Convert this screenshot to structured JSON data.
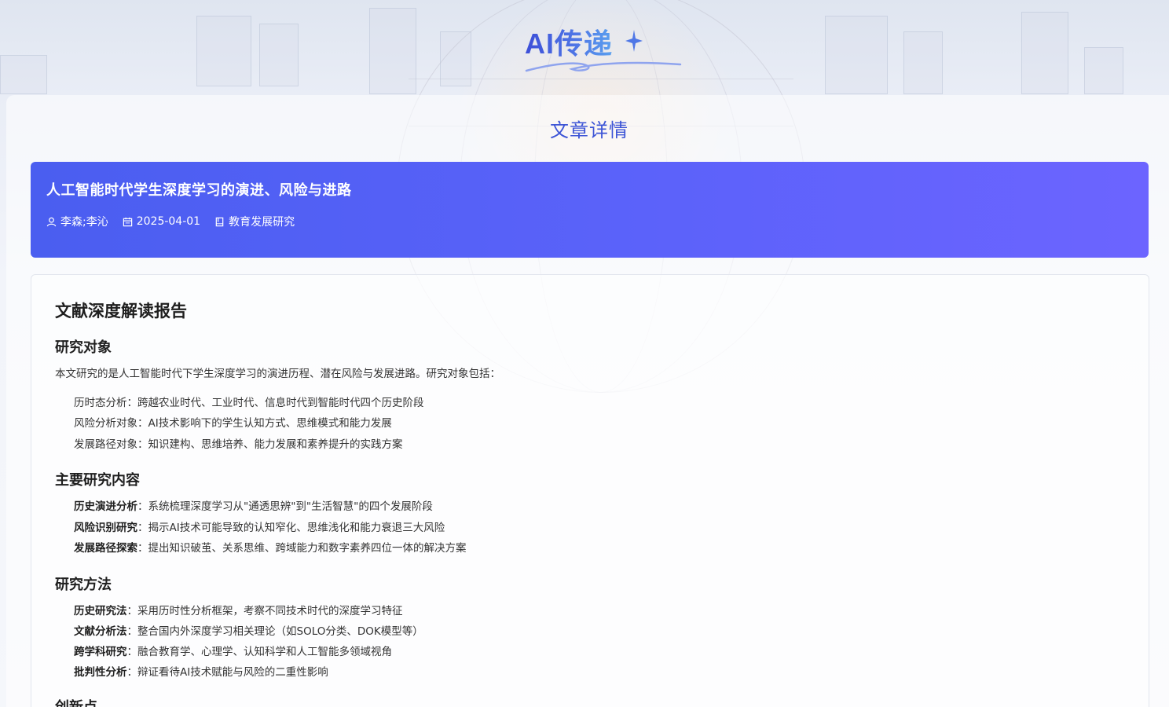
{
  "logo": {
    "text": "AI传递"
  },
  "page_title": "文章详情",
  "article": {
    "title": "人工智能时代学生深度学习的演进、风险与进路",
    "authors": "李森;李沁",
    "date": "2025-04-01",
    "journal": "教育发展研究"
  },
  "report": {
    "title": "文献深度解读报告",
    "sections": {
      "object": {
        "title": "研究对象",
        "intro": "本文研究的是人工智能时代下学生深度学习的演进历程、潜在风险与发展进路。研究对象包括：",
        "items": [
          "历时态分析：跨越农业时代、工业时代、信息时代到智能时代四个历史阶段",
          "风险分析对象：AI技术影响下的学生认知方式、思维模式和能力发展",
          "发展路径对象：知识建构、思维培养、能力发展和素养提升的实践方案"
        ]
      },
      "content": {
        "title": "主要研究内容",
        "items": [
          {
            "label": "历史演进分析",
            "text": "：系统梳理深度学习从\"通透思辨\"到\"生活智慧\"的四个发展阶段"
          },
          {
            "label": "风险识别研究",
            "text": "：揭示AI技术可能导致的认知窄化、思维浅化和能力衰退三大风险"
          },
          {
            "label": "发展路径探索",
            "text": "：提出知识破茧、关系思维、跨域能力和数字素养四位一体的解决方案"
          }
        ]
      },
      "method": {
        "title": "研究方法",
        "items": [
          {
            "label": "历史研究法",
            "text": "：采用历时性分析框架，考察不同技术时代的深度学习特征"
          },
          {
            "label": "文献分析法",
            "text": "：整合国内外深度学习相关理论（如SOLO分类、DOK模型等）"
          },
          {
            "label": "跨学科研究",
            "text": "：融合教育学、心理学、认知科学和人工智能多领域视角"
          },
          {
            "label": "批判性分析",
            "text": "：辩证看待AI技术赋能与风险的二重性影响"
          }
        ]
      },
      "innovation": {
        "title": "创新点"
      }
    }
  },
  "colors": {
    "accent": "#3d55d6",
    "banner_start": "#4a5ef0",
    "banner_end": "#6c64ff"
  },
  "icons": {
    "author": "user-icon",
    "date": "calendar-icon",
    "journal": "book-icon"
  }
}
